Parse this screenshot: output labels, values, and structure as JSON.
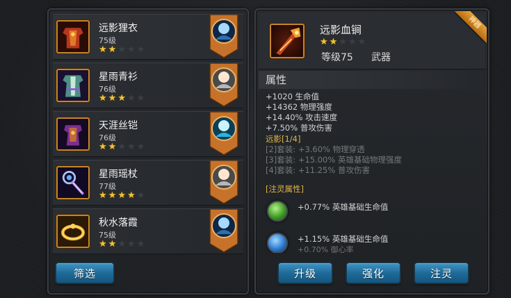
{
  "items": [
    {
      "name": "远影狸衣",
      "level": "75级",
      "stars": 2,
      "icon": "armor-red-icon",
      "hero": "blue-hero-portrait"
    },
    {
      "name": "星雨青衫",
      "level": "76级",
      "stars": 3,
      "icon": "robe-green-icon",
      "hero": "white-hero-portrait"
    },
    {
      "name": "天涯丝铠",
      "level": "76级",
      "stars": 2,
      "icon": "armor-purple-icon",
      "hero": "cyan-hero-portrait"
    },
    {
      "name": "星雨瑶杖",
      "level": "77级",
      "stars": 4,
      "icon": "staff-purple-icon",
      "hero": "white-hero-portrait"
    },
    {
      "name": "秋水落霞",
      "level": "75级",
      "stars": 2,
      "icon": "ring-gold-icon",
      "hero": "blue-hero-portrait"
    }
  ],
  "filter_label": "筛选",
  "detail": {
    "name": "远影血锏",
    "stars": 2,
    "level": "等级75",
    "type": "武器",
    "ribbon": "神器",
    "attr_title": "属性",
    "attrs": [
      "+1020 生命值",
      "+14362 物理强度",
      "+14.40% 攻击速度",
      "+7.50% 普攻伤害"
    ],
    "set_title": "远影[1/4]",
    "set_lines": [
      "[2]套装: +3.60% 物理穿透",
      "[3]套装: +15.00% 英雄基础物理强度",
      "[4]套装: +11.25% 普攻伤害"
    ],
    "spirit_title": "[注灵属性]",
    "spirit": [
      {
        "text": "+0.77% 英雄基础生命值",
        "sub": "",
        "gem": "green"
      },
      {
        "text": "+1.15% 英雄基础生命值",
        "sub": "+0.70% 御心率",
        "gem": "blue"
      }
    ]
  },
  "buttons": {
    "upgrade": "升级",
    "enhance": "强化",
    "infuse": "注灵"
  },
  "colors": {
    "gold_border": "#c7862b",
    "button_blue": "#1f6b9a",
    "star": "#f2c436",
    "set_gold": "#e0b547"
  }
}
